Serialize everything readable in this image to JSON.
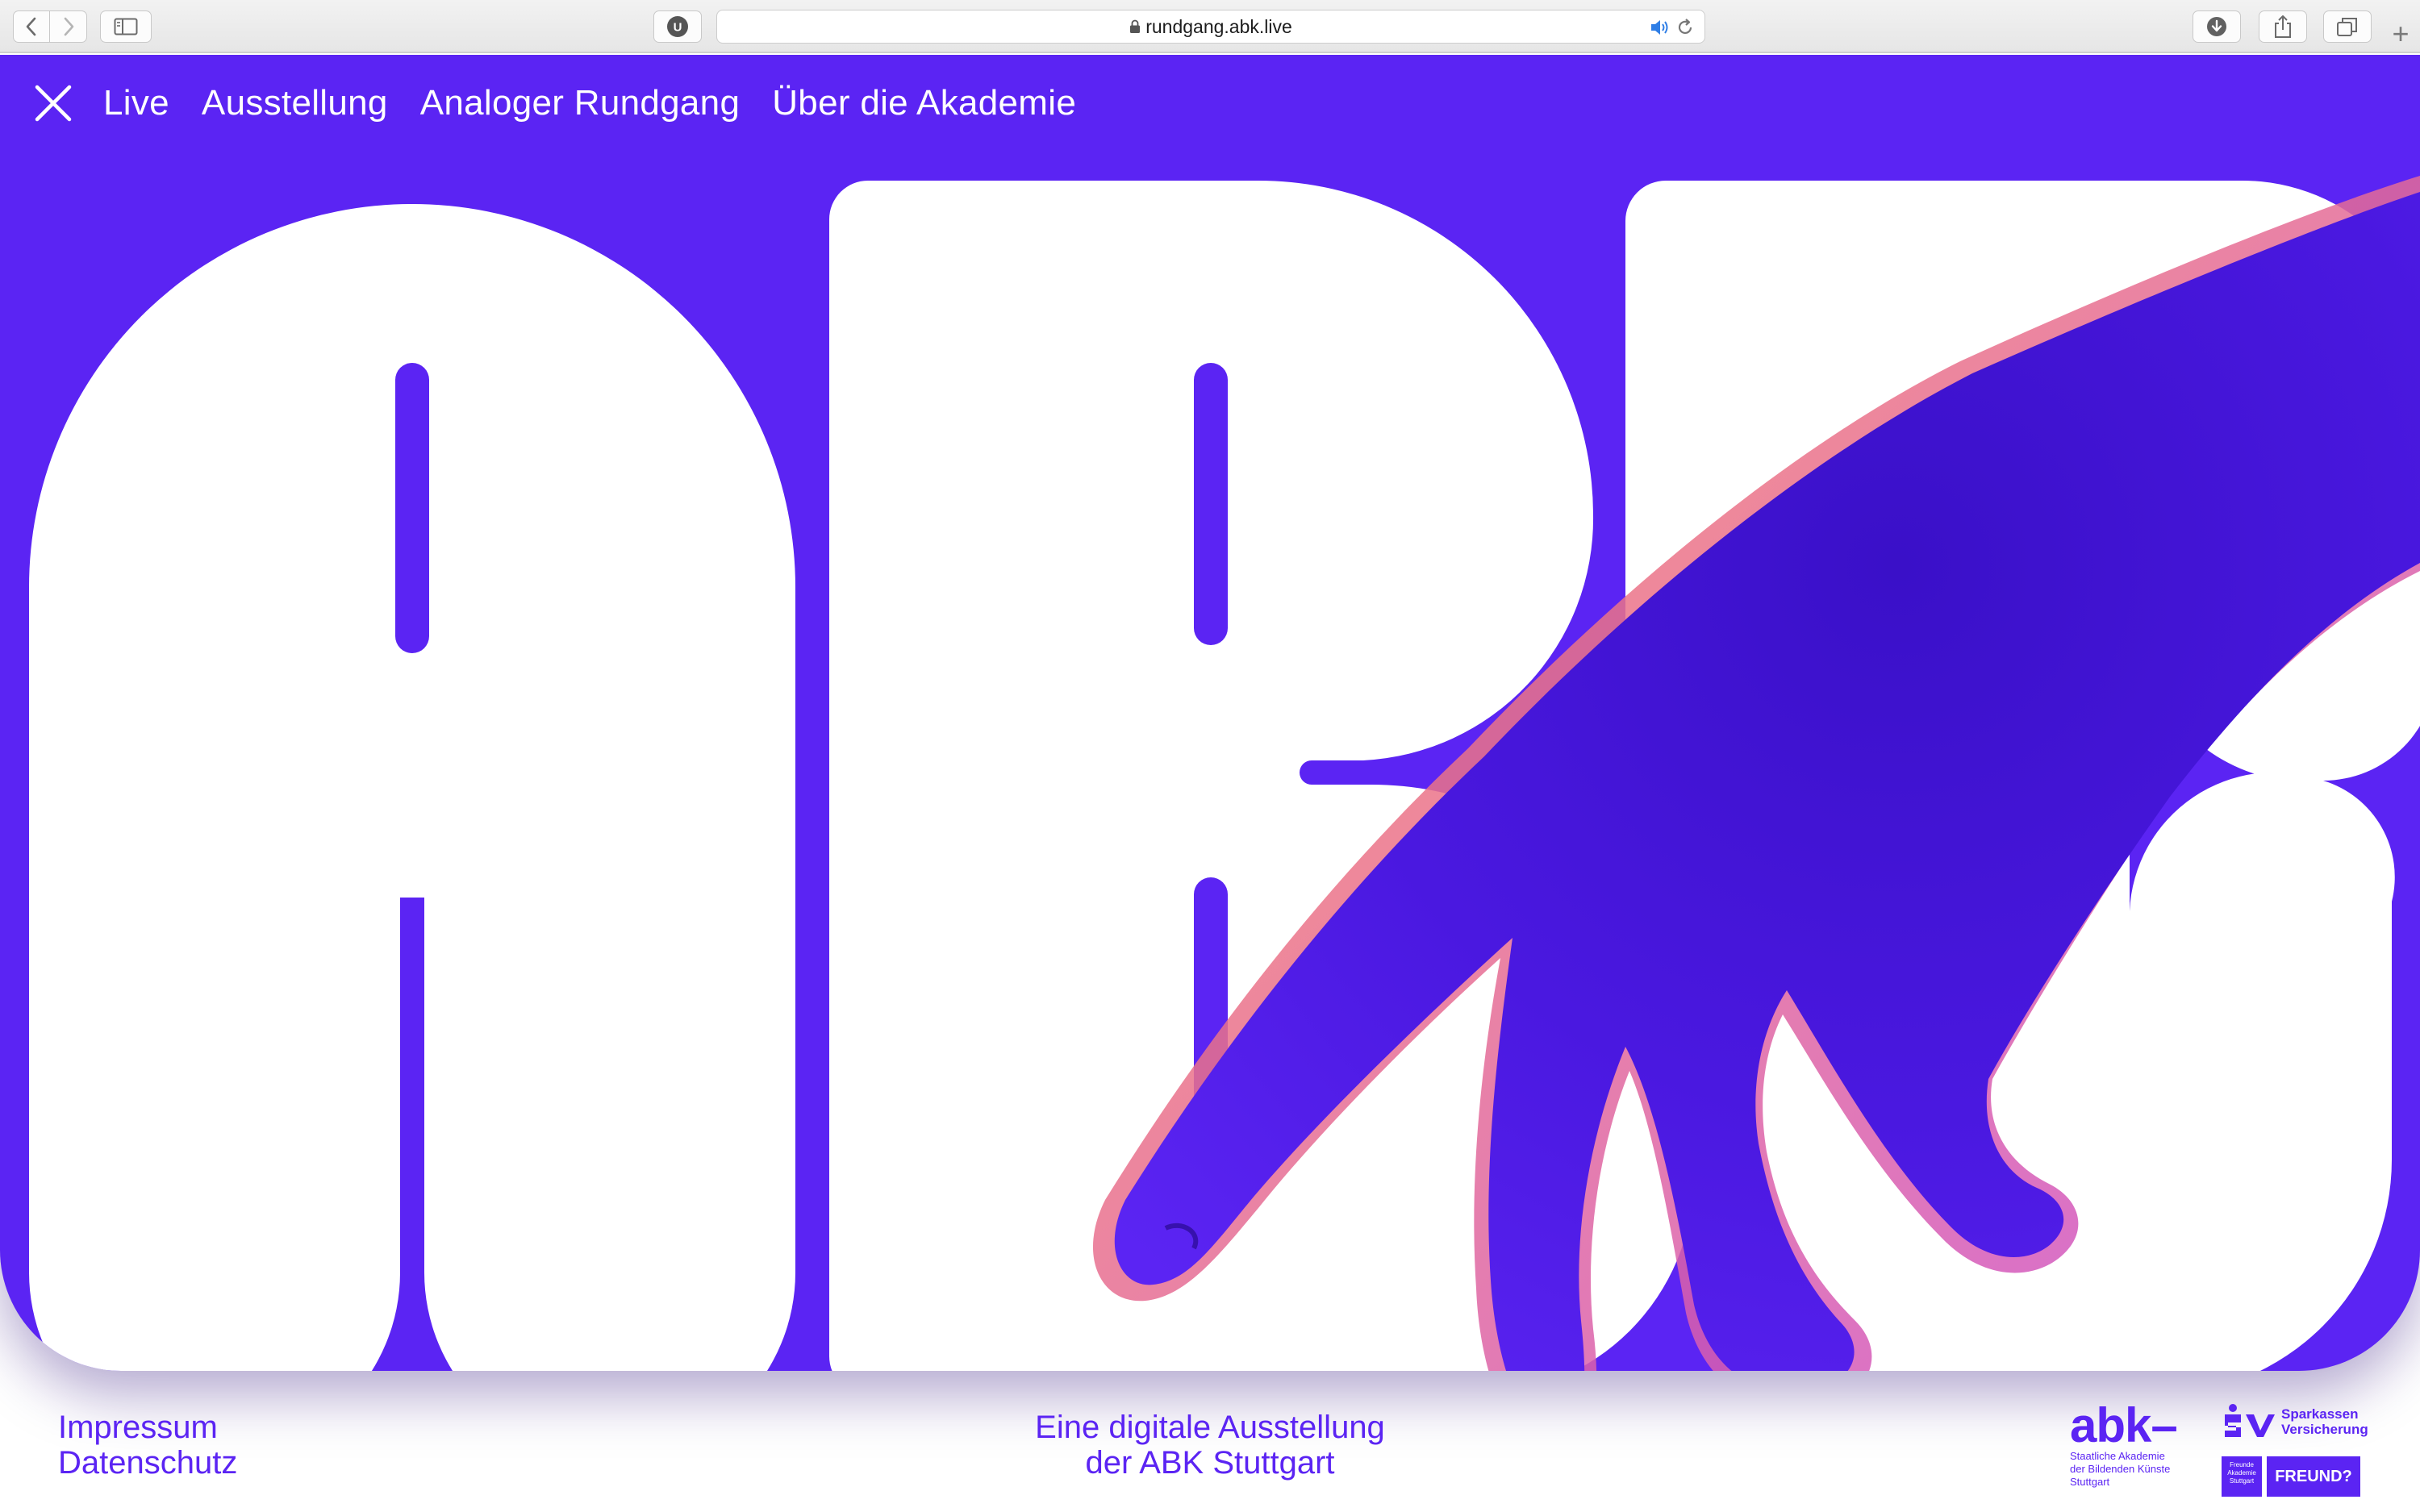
{
  "browser": {
    "url": "rundgang.abk.live",
    "extension_badge": "U"
  },
  "nav": {
    "items": [
      "Live",
      "Ausstellung",
      "Analoger Rundgang",
      "Über die Akademie"
    ]
  },
  "footer": {
    "impressum": "Impressum",
    "datenschutz": "Datenschutz",
    "tagline_line1": "Eine digitale Ausstellung",
    "tagline_line2": "der ABK Stuttgart"
  },
  "logos": {
    "abk_word": "abk–",
    "abk_sub1": "Staatliche Akademie",
    "abk_sub2": "der Bildenden Künste",
    "abk_sub3": "Stuttgart",
    "sv_line1": "Sparkassen",
    "sv_line2": "Versicherung",
    "freunde_box": "Freunde Akademie Stuttgart",
    "freund": "FREUND?"
  },
  "colors": {
    "brand": "#5b24f3",
    "white": "#ffffff"
  }
}
